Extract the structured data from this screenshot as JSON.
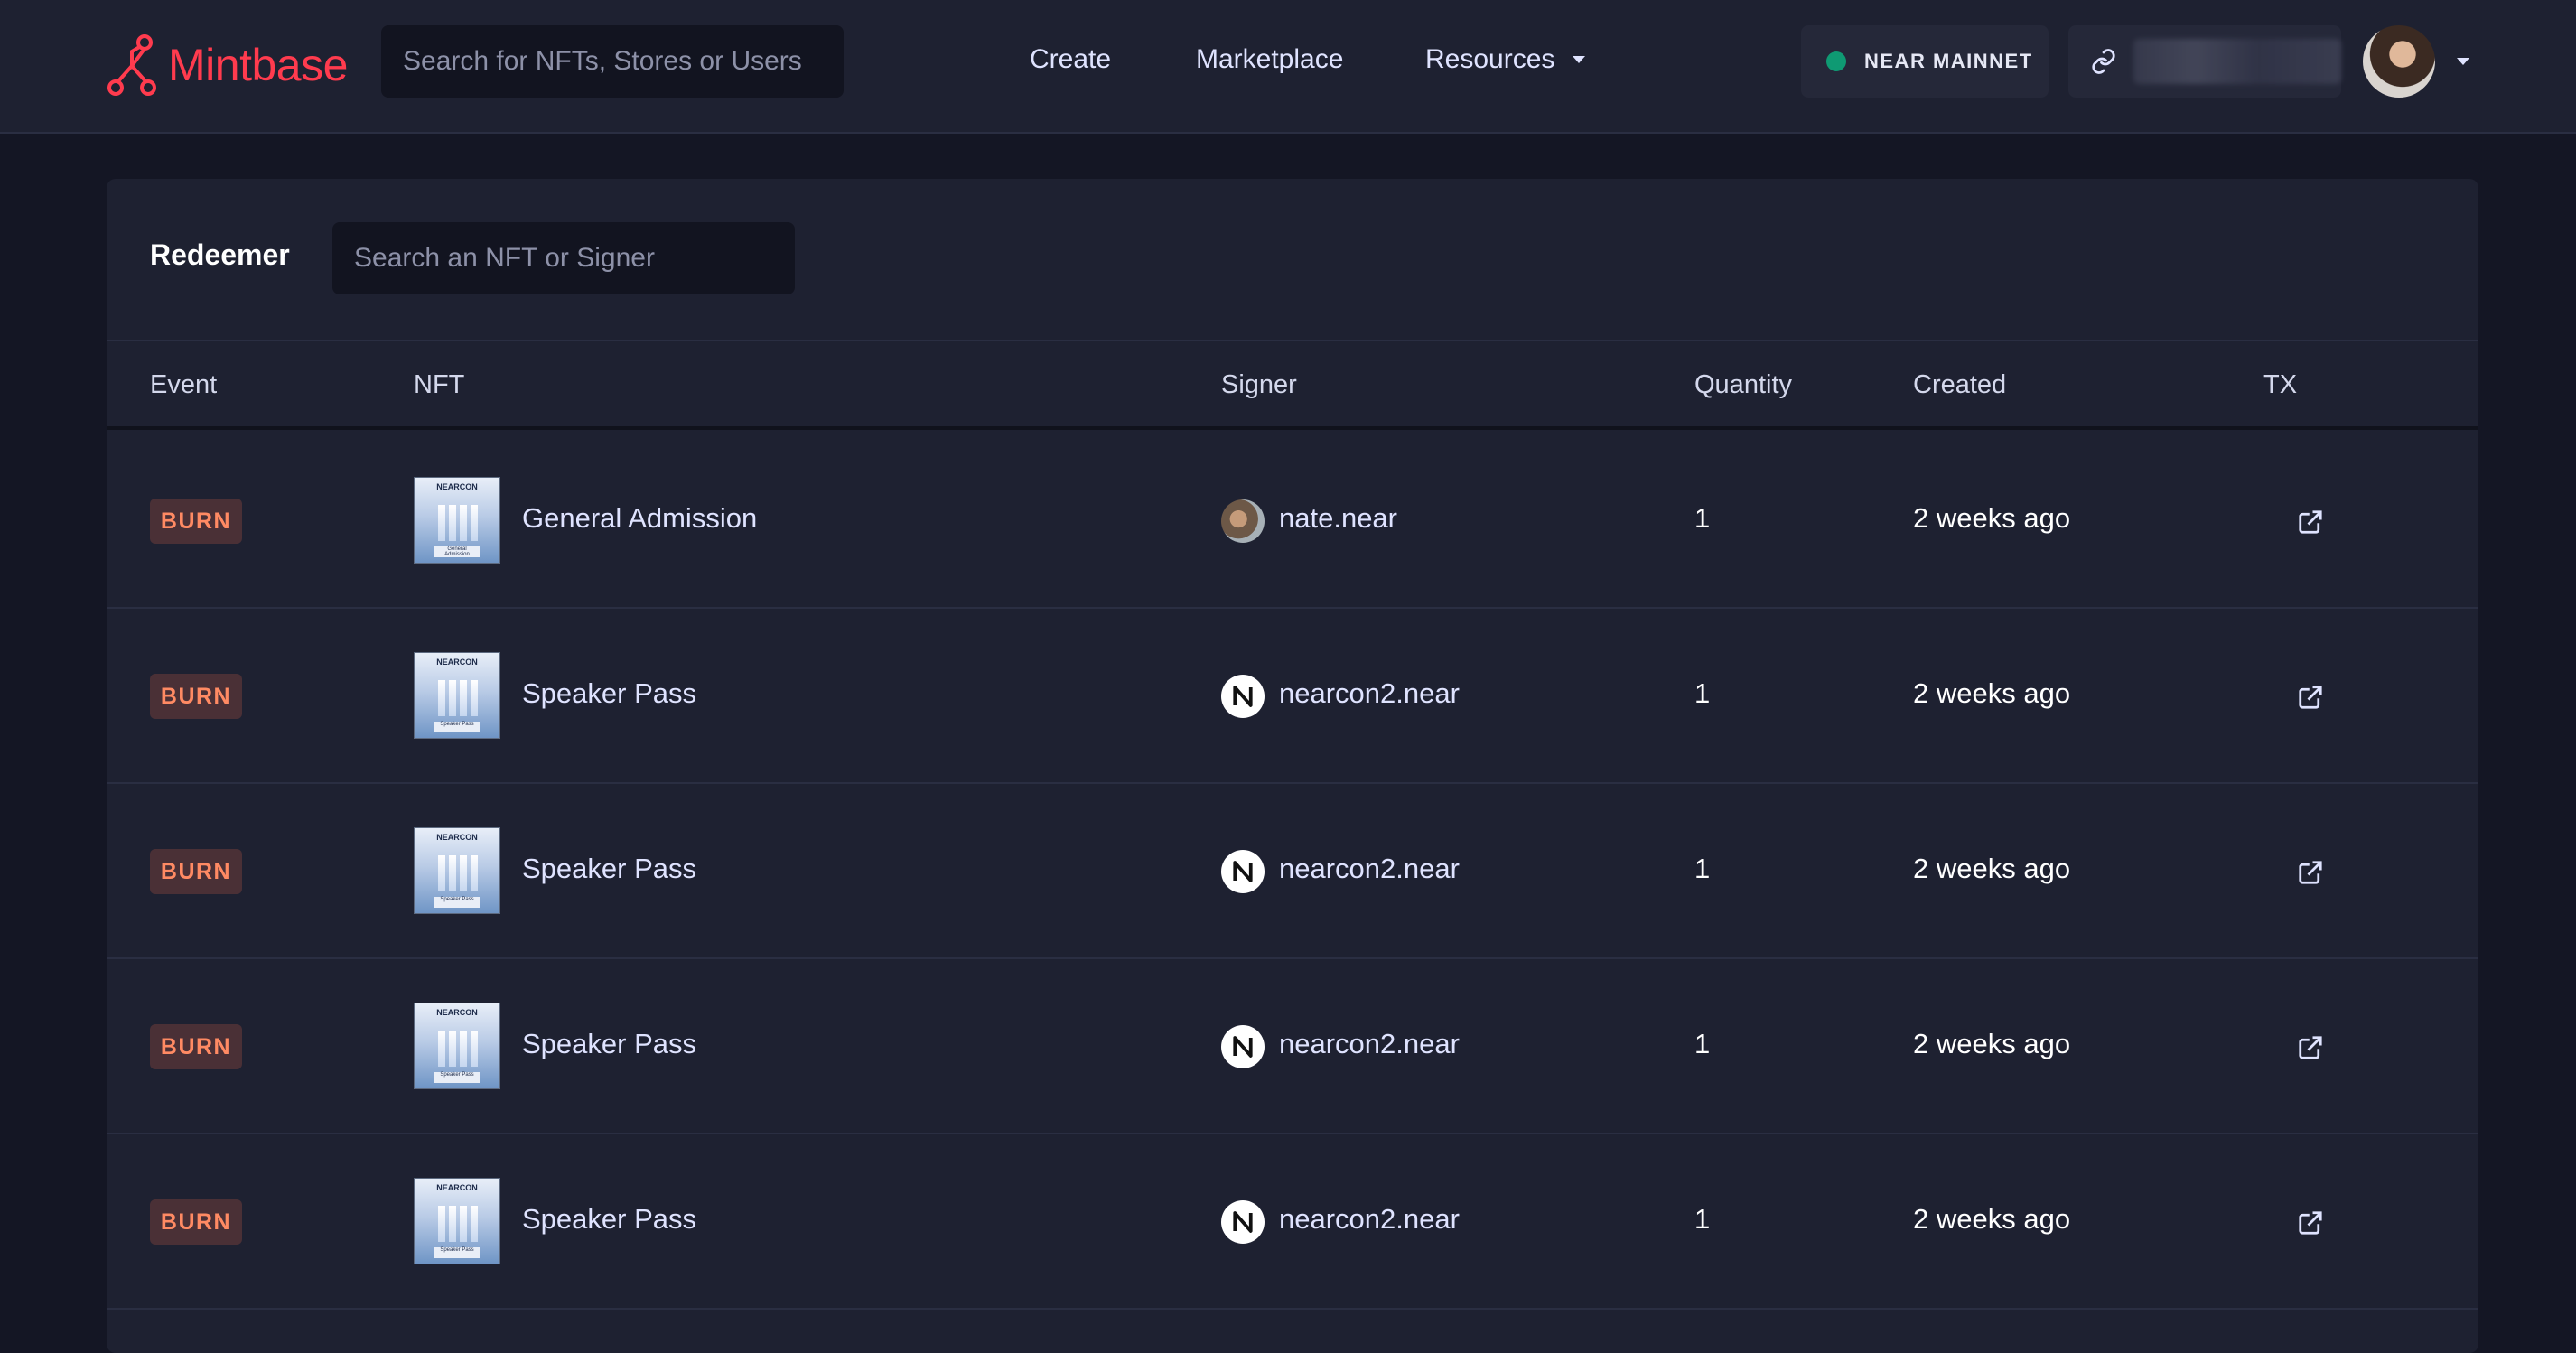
{
  "header": {
    "logo_text": "Mintbase",
    "search_placeholder": "Search for NFTs, Stores or Users",
    "nav": {
      "create": "Create",
      "marketplace": "Marketplace",
      "resources": "Resources"
    },
    "network_label": "NEAR MAINNET",
    "network_status_color": "#0f9a73",
    "brand_color": "#ff3b4e"
  },
  "panel": {
    "title": "Redeemer",
    "search_placeholder": "Search an NFT or Signer",
    "columns": {
      "event": "Event",
      "nft": "NFT",
      "signer": "Signer",
      "quantity": "Quantity",
      "created": "Created",
      "tx": "TX"
    },
    "rows": [
      {
        "event": "BURN",
        "nft_name": "General Admission",
        "thumb_title": "NEARCON",
        "thumb_label": "General Admission",
        "signer": "nate.near",
        "signer_avatar": "photo",
        "quantity": "1",
        "created": "2 weeks ago",
        "tx_icon": "external-link-icon"
      },
      {
        "event": "BURN",
        "nft_name": "Speaker Pass",
        "thumb_title": "NEARCON",
        "thumb_label": "Speaker Pass",
        "signer": "nearcon2.near",
        "signer_avatar": "near-logo",
        "quantity": "1",
        "created": "2 weeks ago",
        "tx_icon": "external-link-icon"
      },
      {
        "event": "BURN",
        "nft_name": "Speaker Pass",
        "thumb_title": "NEARCON",
        "thumb_label": "Speaker Pass",
        "signer": "nearcon2.near",
        "signer_avatar": "near-logo",
        "quantity": "1",
        "created": "2 weeks ago",
        "tx_icon": "external-link-icon"
      },
      {
        "event": "BURN",
        "nft_name": "Speaker Pass",
        "thumb_title": "NEARCON",
        "thumb_label": "Speaker Pass",
        "signer": "nearcon2.near",
        "signer_avatar": "near-logo",
        "quantity": "1",
        "created": "2 weeks ago",
        "tx_icon": "external-link-icon"
      },
      {
        "event": "BURN",
        "nft_name": "Speaker Pass",
        "thumb_title": "NEARCON",
        "thumb_label": "Speaker Pass",
        "signer": "nearcon2.near",
        "signer_avatar": "near-logo",
        "quantity": "1",
        "created": "2 weeks ago",
        "tx_icon": "external-link-icon"
      }
    ]
  }
}
